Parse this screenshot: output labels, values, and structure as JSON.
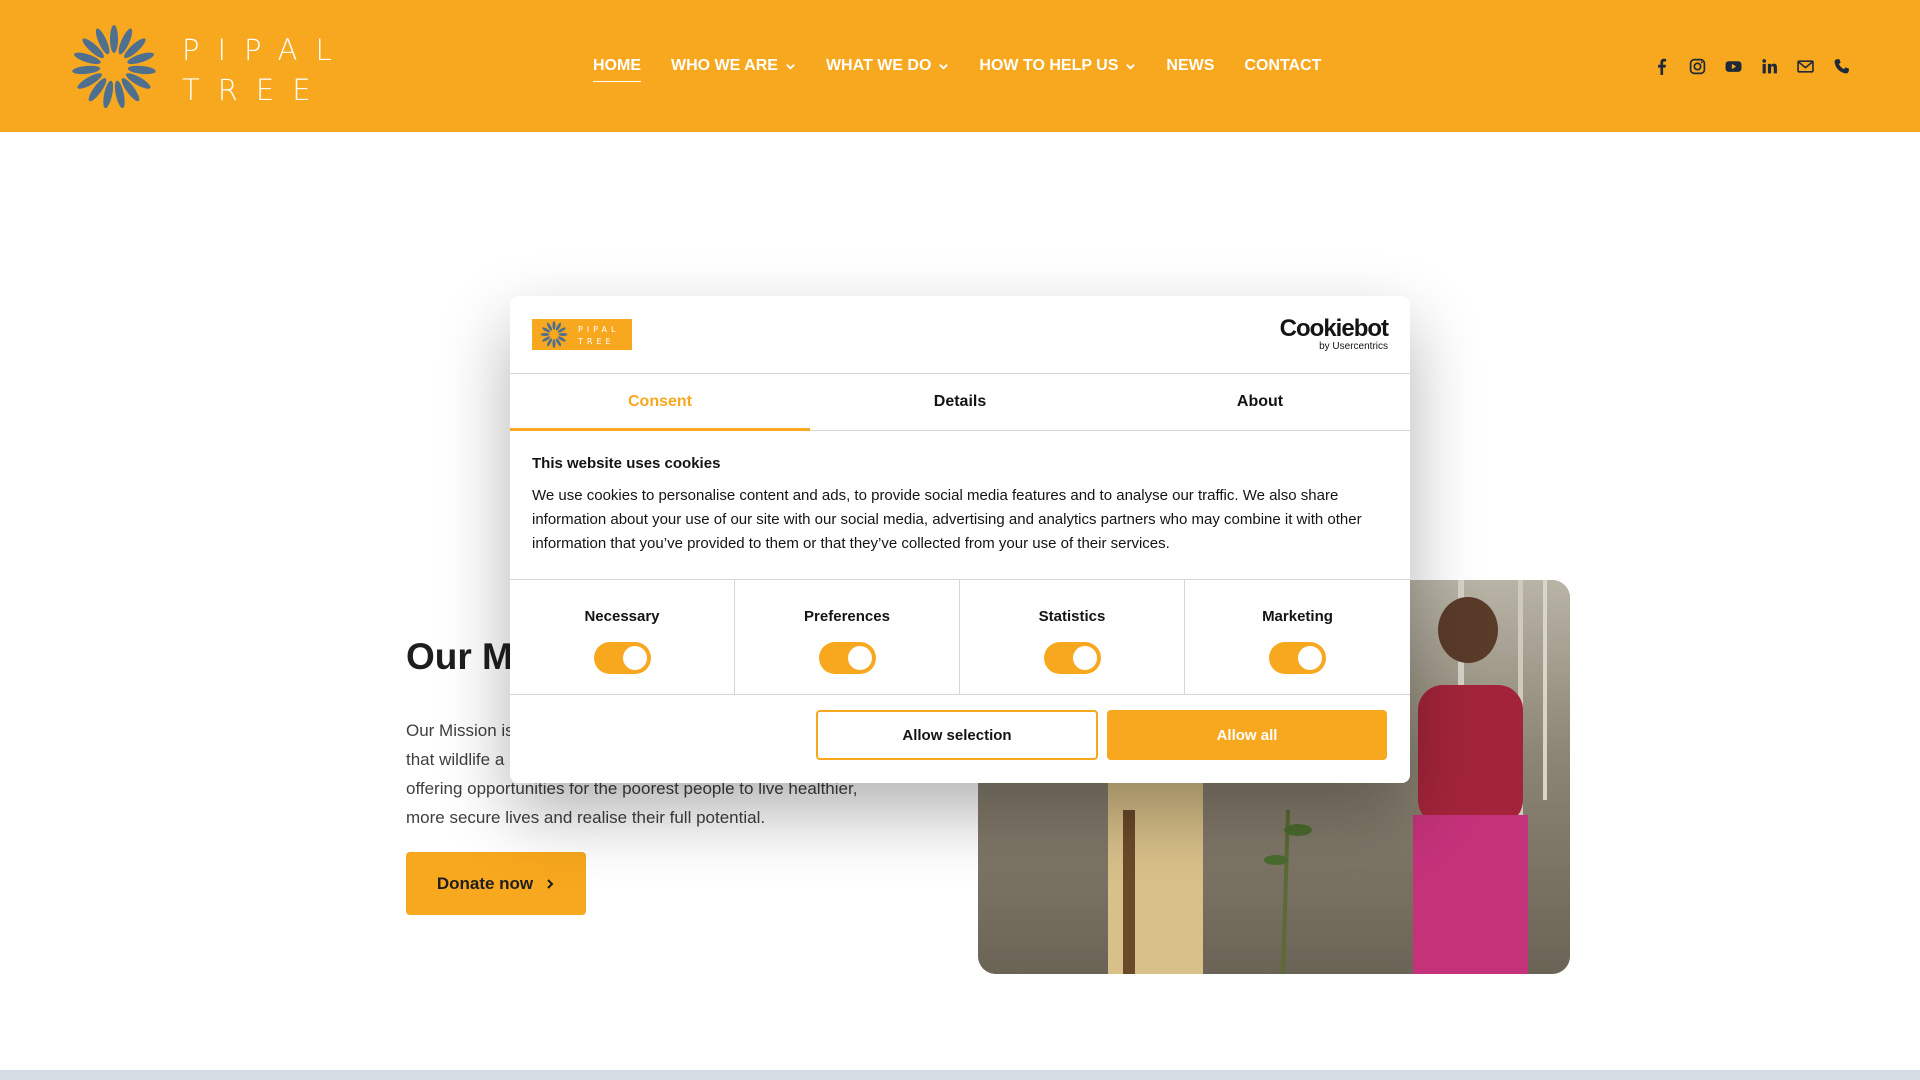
{
  "brand": {
    "logo_line1": "PIPAL",
    "logo_line2": "TREE",
    "logo_icon": "pipal-sun-icon",
    "primary_color": "#F8A81E"
  },
  "nav": {
    "items": [
      {
        "label": "HOME",
        "active": true,
        "dropdown": false
      },
      {
        "label": "WHO WE ARE",
        "active": false,
        "dropdown": true
      },
      {
        "label": "WHAT WE DO",
        "active": false,
        "dropdown": true
      },
      {
        "label": "HOW TO HELP US",
        "active": false,
        "dropdown": true
      },
      {
        "label": "NEWS",
        "active": false,
        "dropdown": false
      },
      {
        "label": "CONTACT",
        "active": false,
        "dropdown": false
      }
    ]
  },
  "social": [
    "facebook-icon",
    "instagram-icon",
    "youtube-icon",
    "linkedin-icon",
    "email-icon",
    "phone-icon"
  ],
  "main": {
    "mission_title": "Our Mi",
    "mission_text_line1": "Our Mission is",
    "mission_text_line2": "that wildlife a",
    "mission_text_line3": "offering opportunities for the poorest people to live healthier,",
    "mission_text_line4": "more secure lives and realise their full potential.",
    "donate_label": "Donate now"
  },
  "cookie_dialog": {
    "brand_name": "Cookiebot",
    "brand_sub": "by Usercentrics",
    "tabs": [
      {
        "label": "Consent",
        "active": true
      },
      {
        "label": "Details",
        "active": false
      },
      {
        "label": "About",
        "active": false
      }
    ],
    "heading": "This website uses cookies",
    "body": "We use cookies to personalise content and ads, to provide social media features and to analyse our traffic. We also share information about your use of our site with our social media, advertising and analytics partners who may combine it with other information that you’ve provided to them or that they’ve collected from your use of their services.",
    "categories": [
      {
        "label": "Necessary",
        "enabled": true
      },
      {
        "label": "Preferences",
        "enabled": true
      },
      {
        "label": "Statistics",
        "enabled": true
      },
      {
        "label": "Marketing",
        "enabled": true
      }
    ],
    "allow_selection_label": "Allow selection",
    "allow_all_label": "Allow all"
  }
}
